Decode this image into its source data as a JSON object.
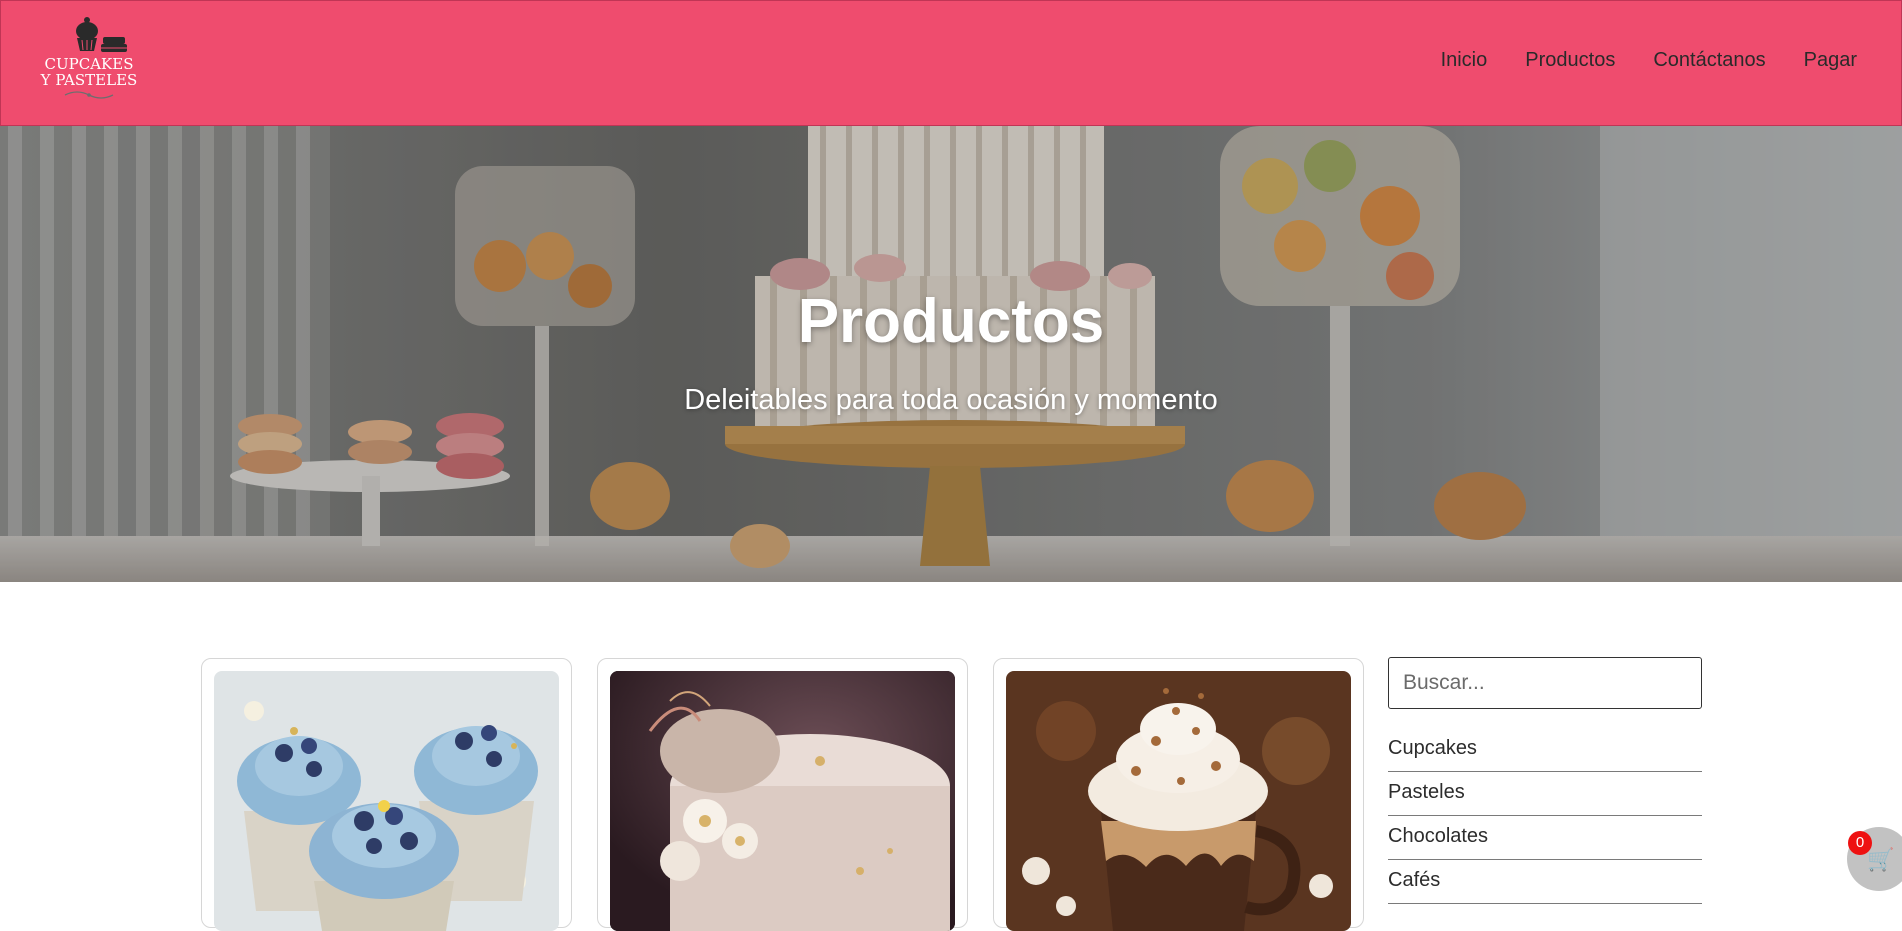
{
  "brand": {
    "logo_line1": "CUPCAKES",
    "logo_line2": "Y PASTELES"
  },
  "nav": {
    "items": [
      "Inicio",
      "Productos",
      "Contáctanos",
      "Pagar"
    ]
  },
  "hero": {
    "title": "Productos",
    "subtitle": "Deleitables para toda ocasión y momento"
  },
  "products": [
    {
      "image": "blueberry-cupcakes"
    },
    {
      "image": "floral-cake"
    },
    {
      "image": "hot-chocolate"
    }
  ],
  "sidebar": {
    "search_placeholder": "Buscar...",
    "categories": [
      "Cupcakes",
      "Pasteles",
      "Chocolates",
      "Cafés"
    ]
  },
  "cart": {
    "count": "0",
    "icon": "cart-icon"
  },
  "colors": {
    "navbar": "#ef4c6e",
    "badge": "#ee1111"
  }
}
